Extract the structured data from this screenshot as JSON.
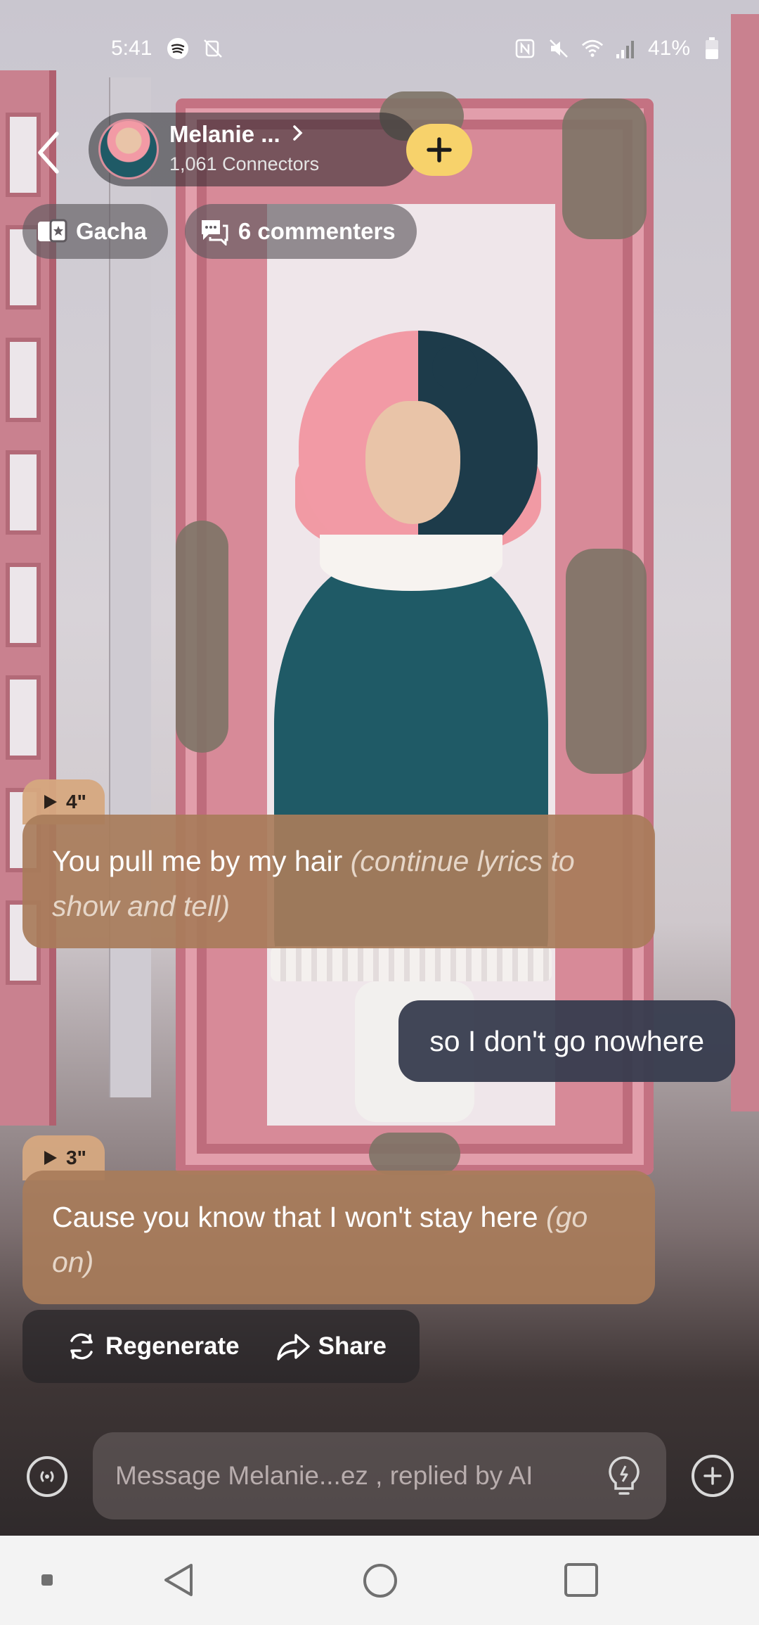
{
  "status_bar": {
    "time": "5:41",
    "battery": "41%",
    "left_icons": [
      "spotify-icon",
      "notification-off-icon"
    ],
    "right_icons": [
      "nfc-icon",
      "mute-icon",
      "wifi-icon",
      "signal-icon",
      "battery-icon"
    ]
  },
  "header": {
    "back_icon": "chevron-left-icon",
    "profile_name": "Melanie ...",
    "connectors": "1,061 Connectors",
    "follow_icon": "plus-icon"
  },
  "chips": {
    "gacha": "Gacha",
    "commenters": "6 commenters"
  },
  "messages": [
    {
      "role": "ai",
      "duration": "4\"",
      "text": "You pull me by my hair ",
      "action": "(continue lyrics to show and tell)"
    },
    {
      "role": "user",
      "text": "so I don't go nowhere"
    },
    {
      "role": "ai",
      "duration": "3\"",
      "text": "Cause you know that I won't stay here ",
      "action": "(go on)"
    }
  ],
  "actions": {
    "regenerate": "Regenerate",
    "share": "Share"
  },
  "composer": {
    "placeholder": "Message Melanie...ez , replied by AI"
  },
  "colors": {
    "ai_bubble": "#a87c5a",
    "user_bubble": "#373c4e",
    "follow_button": "#f7d26b",
    "navbar": "#f3f3f3"
  }
}
